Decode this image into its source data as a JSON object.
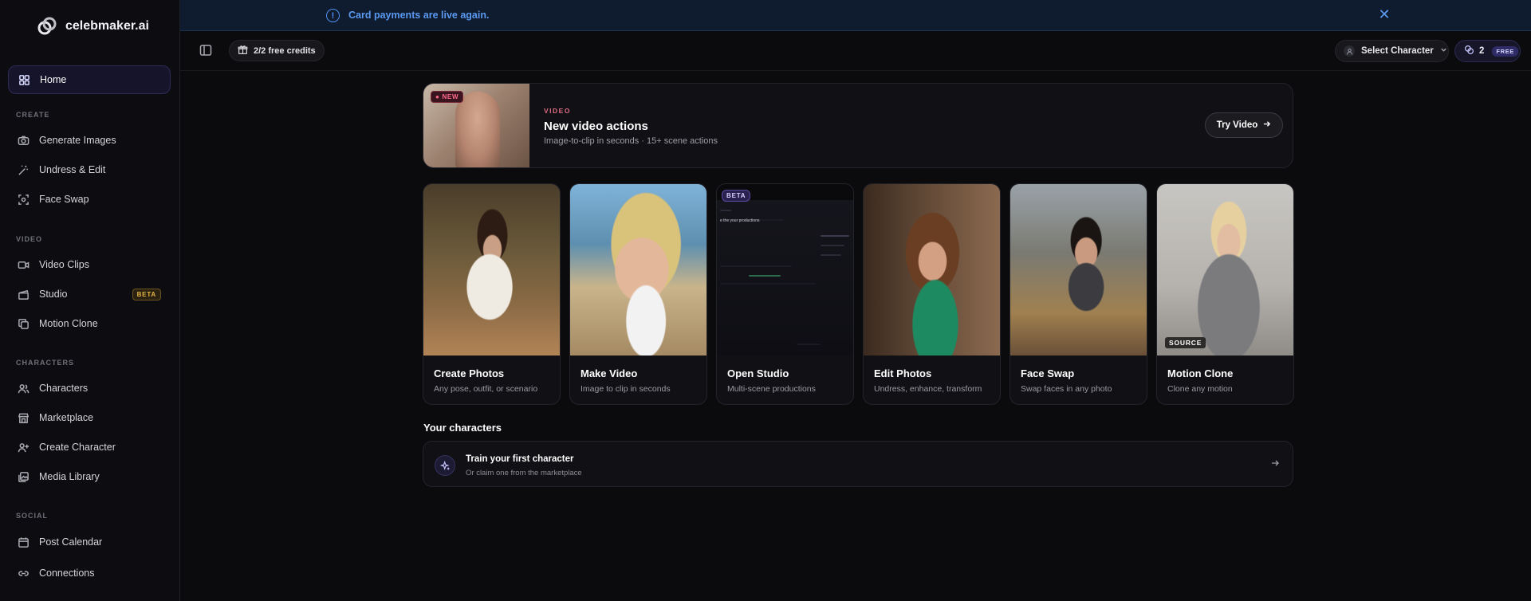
{
  "brand": {
    "name": "celebmaker.ai"
  },
  "banner": {
    "text": "Card payments are live again.",
    "info_icon": "info-icon",
    "close_icon": "close-icon"
  },
  "topbar": {
    "credits_label": "2/2 free credits",
    "select_character_label": "Select Character",
    "coin_count": "2",
    "plan_tag": "FREE"
  },
  "sidebar": {
    "home": "Home",
    "sections": {
      "create": "CREATE",
      "video": "VIDEO",
      "characters": "CHARACTERS",
      "social": "SOCIAL"
    },
    "items": {
      "generate_images": "Generate Images",
      "undress_edit": "Undress & Edit",
      "face_swap": "Face Swap",
      "video_clips": "Video Clips",
      "studio": "Studio",
      "studio_badge": "BETA",
      "motion_clone": "Motion Clone",
      "characters": "Characters",
      "marketplace": "Marketplace",
      "create_character": "Create Character",
      "media_library": "Media Library",
      "post_calendar": "Post Calendar",
      "connections": "Connections"
    }
  },
  "hero": {
    "badge": "● NEW",
    "kicker": "VIDEO",
    "title": "New video actions",
    "subtitle": "Image-to-clip in seconds · 15+ scene actions",
    "button": "Try Video"
  },
  "cards": [
    {
      "title": "Create Photos",
      "subtitle": "Any pose, outfit, or scenario"
    },
    {
      "title": "Make Video",
      "subtitle": "Image to clip in seconds"
    },
    {
      "title": "Open Studio",
      "subtitle": "Multi-scene productions",
      "badge": "BETA",
      "preview_text": "e the your productions"
    },
    {
      "title": "Edit Photos",
      "subtitle": "Undress, enhance, transform"
    },
    {
      "title": "Face Swap",
      "subtitle": "Swap faces in any photo"
    },
    {
      "title": "Motion Clone",
      "subtitle": "Clone any motion",
      "tag": "SOURCE"
    }
  ],
  "characters_section": {
    "title": "Your characters",
    "row_title": "Train your first character",
    "row_subtitle": "Or claim one from the marketplace"
  },
  "colors": {
    "accent": "#2d2b55",
    "banner_text": "#5a9af2",
    "beta_badge": "#e5b545",
    "new_badge": "#ff6c8a",
    "background": "#0b0b0e"
  }
}
